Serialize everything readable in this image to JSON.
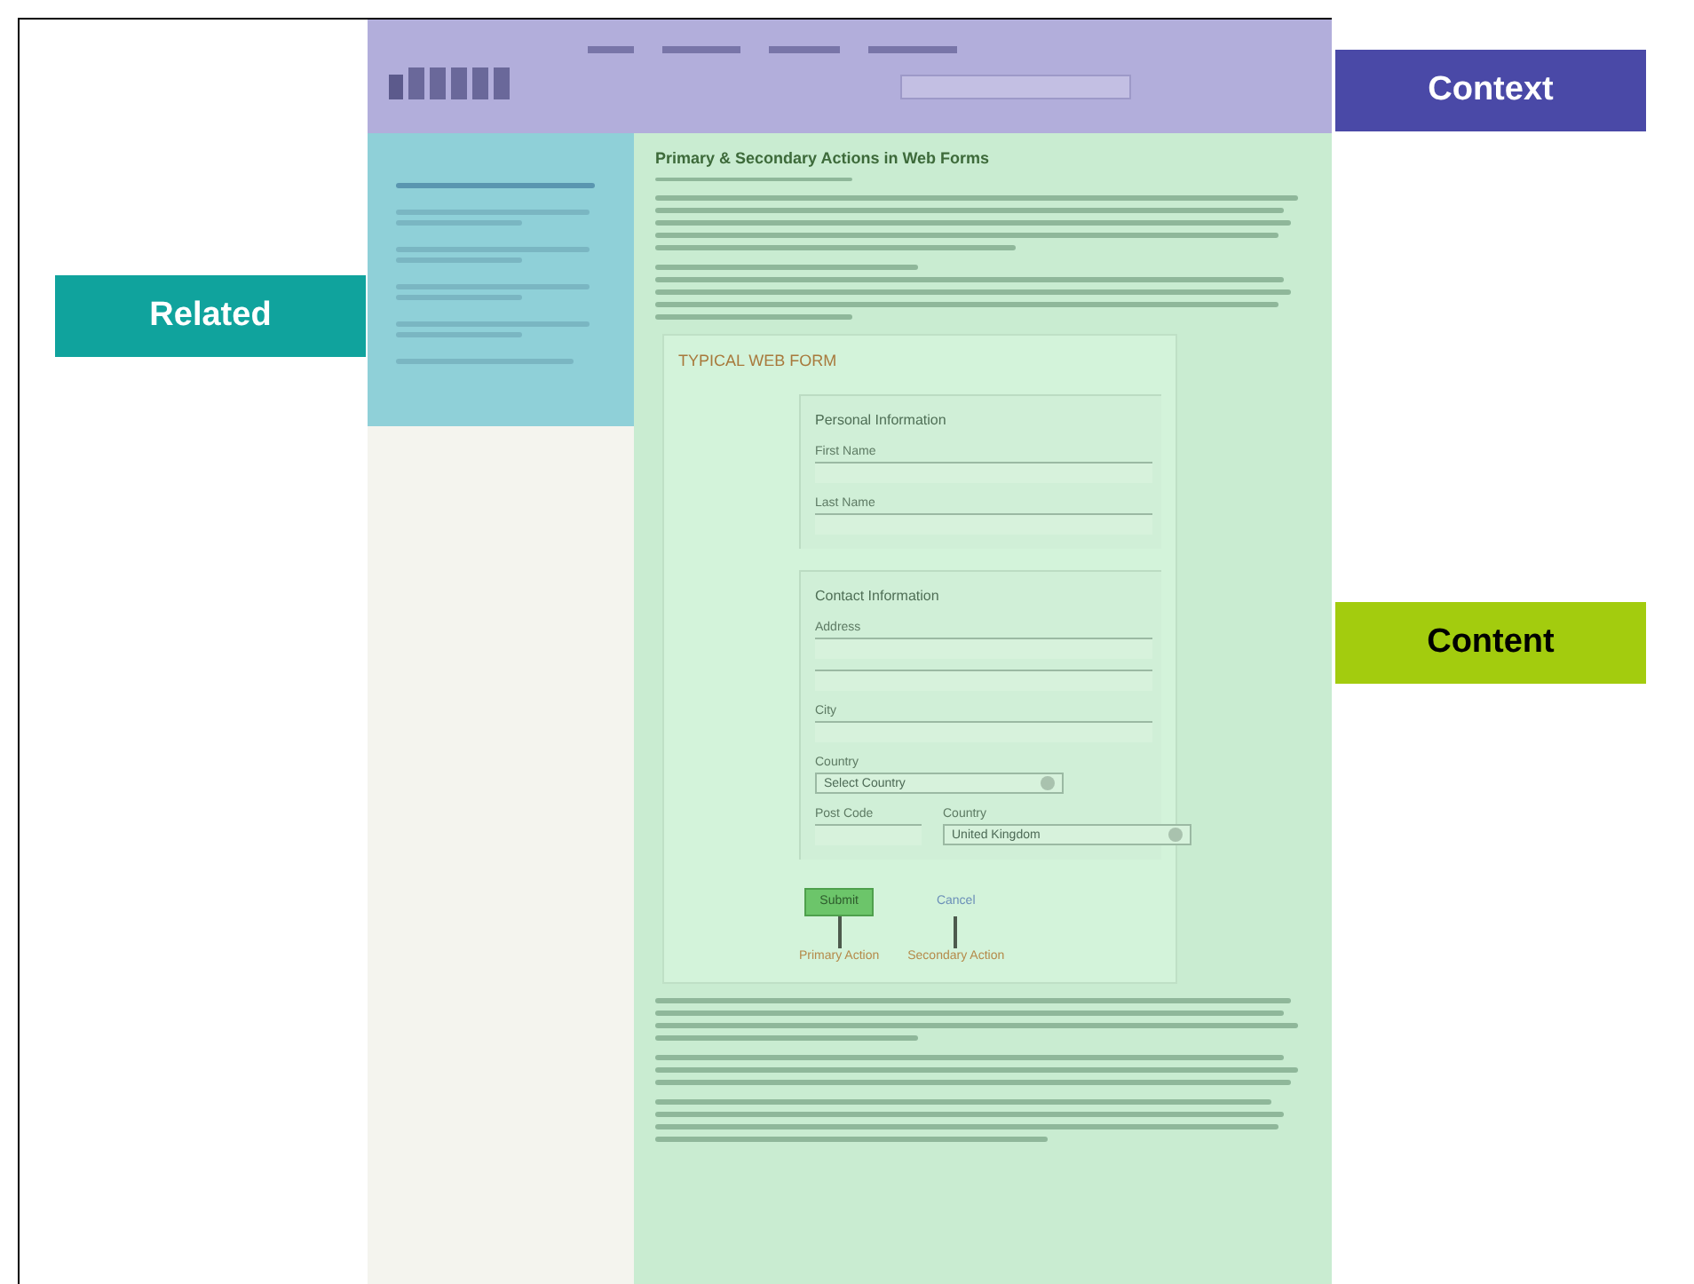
{
  "annotations": [
    {
      "label": "Context",
      "color": "#4a49a7"
    },
    {
      "label": "Related",
      "color": "#10a39d"
    },
    {
      "label": "Content",
      "color": "#a3cc0e"
    }
  ],
  "article": {
    "title": "Primary & Secondary Actions in Web Forms"
  },
  "form": {
    "title": "TYPICAL WEB FORM",
    "sections": [
      {
        "heading": "Personal Information",
        "fields": [
          {
            "label": "First Name",
            "kind": "text"
          },
          {
            "label": "Last Name",
            "kind": "text"
          }
        ]
      },
      {
        "heading": "Contact Information",
        "fields": [
          {
            "label": "Address",
            "kind": "address"
          },
          {
            "label": "City",
            "kind": "text"
          },
          {
            "label": "Country",
            "kind": "select",
            "value": "Select Country"
          }
        ],
        "inline_fields": [
          {
            "label": "Post Code",
            "kind": "text"
          },
          {
            "label": "Country",
            "kind": "select",
            "value": "United Kingdom"
          }
        ]
      }
    ],
    "actions": [
      {
        "label": "Submit",
        "kind": "button",
        "callout": "Primary Action"
      },
      {
        "label": "Cancel",
        "kind": "link",
        "callout": "Secondary Action"
      }
    ]
  }
}
